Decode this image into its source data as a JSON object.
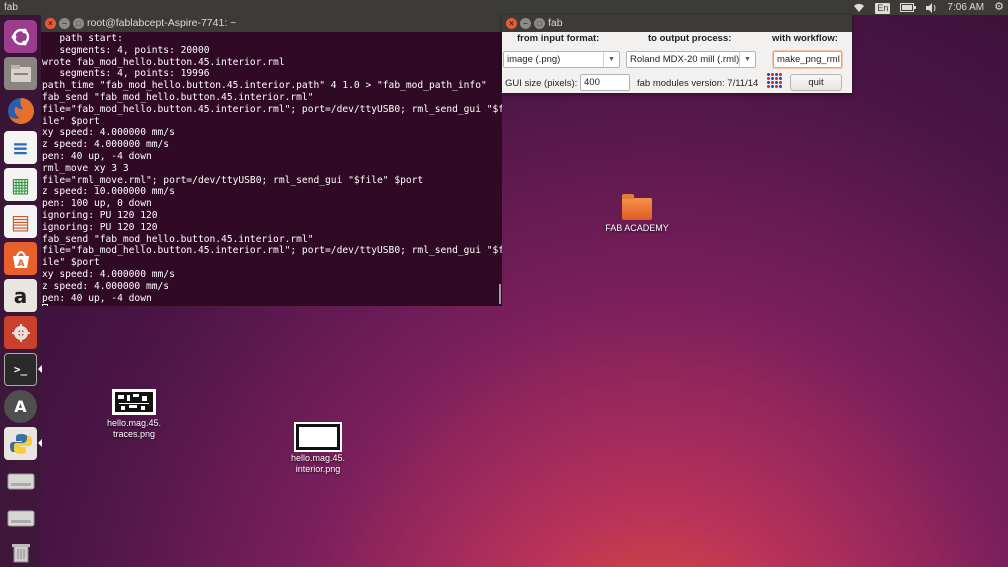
{
  "top_panel": {
    "app_name": "fab",
    "keyboard_layout": "En",
    "time": "7:06 AM",
    "icons": [
      "wifi-icon",
      "keyboard-icon",
      "battery-icon",
      "volume-icon",
      "settings-gear-icon"
    ]
  },
  "launcher": {
    "items": [
      {
        "name": "ubuntu-dash-icon",
        "color": "#9c3c8c"
      },
      {
        "name": "files-icon",
        "color": "#8a8580"
      },
      {
        "name": "firefox-icon",
        "color": "#e0672a"
      },
      {
        "name": "libreoffice-writer-icon",
        "color": "#2d6cb5"
      },
      {
        "name": "libreoffice-calc-icon",
        "color": "#2f9b3e"
      },
      {
        "name": "libreoffice-impress-icon",
        "color": "#d0562f"
      },
      {
        "name": "software-center-icon",
        "color": "#e8612c"
      },
      {
        "name": "amazon-icon",
        "color": "#d9d5cf"
      },
      {
        "name": "system-settings-icon",
        "color": "#c9402d"
      },
      {
        "name": "terminal-icon",
        "color": "#2a2a2a"
      },
      {
        "name": "software-updater-icon",
        "color": "#4f4f4f"
      },
      {
        "name": "python-icon",
        "color": "#3a6ea5"
      },
      {
        "name": "drive-icon",
        "color": "#bfbfbf"
      },
      {
        "name": "drive-2-icon",
        "color": "#bfbfbf"
      },
      {
        "name": "trash-icon",
        "color": "#9a9a9a"
      }
    ],
    "labels": {
      "amazon": "a",
      "terminal": ">_",
      "software_updater": "A",
      "writer": "≡",
      "calc": "▦",
      "impress": "▤"
    }
  },
  "terminal": {
    "title": "root@fablabcept-Aspire-7741: ~",
    "lines": [
      "   path start:",
      "   segments: 4, points: 20000",
      "wrote fab_mod_hello.button.45.interior.rml",
      "   segments: 4, points: 19996",
      "path_time \"fab_mod_hello.button.45.interior.path\" 4 1.0 > \"fab_mod_path_info\"",
      "fab_send \"fab_mod_hello.button.45.interior.rml\"",
      "file=\"fab_mod_hello.button.45.interior.rml\"; port=/dev/ttyUSB0; rml_send_gui \"$f",
      "ile\" $port",
      "xy speed: 4.000000 mm/s",
      "z speed: 4.000000 mm/s",
      "pen: 40 up, -4 down",
      "rml_move xy 3 3",
      "file=\"rml_move.rml\"; port=/dev/ttyUSB0; rml_send_gui \"$file\" $port",
      "z speed: 10.000000 mm/s",
      "pen: 100 up, 0 down",
      "ignoring: PU 120 120",
      "ignoring: PU 120 120",
      "fab_send \"fab_mod_hello.button.45.interior.rml\"",
      "file=\"fab_mod_hello.button.45.interior.rml\"; port=/dev/ttyUSB0; rml_send_gui \"$f",
      "ile\" $port",
      "xy speed: 4.000000 mm/s",
      "z speed: 4.000000 mm/s",
      "pen: 40 up, -4 down",
      ""
    ]
  },
  "fab_window": {
    "title": "fab",
    "from_label": "from input format:",
    "to_label": "to output process:",
    "workflow_label": "with workflow:",
    "input_format": "image (.png)",
    "output_process": "Roland MDX-20 mill (.rml)",
    "workflow": "make_png_rml",
    "gui_size_label": "GUI size (pixels):",
    "gui_size_value": "400",
    "version_text": "fab modules version: 7/11/14",
    "quit_label": "quit"
  },
  "desktop": {
    "icons": [
      {
        "label": "FAB ACADEMY",
        "type": "folder"
      },
      {
        "label": "hello.mag.45.\ntraces.png",
        "type": "image"
      },
      {
        "label": "hello.mag.45.\ninterior.png",
        "type": "image"
      }
    ]
  },
  "colors": {
    "terminal_bg": "#300a24",
    "panel_bg": "#3c3b37",
    "close_button": "#e8593a",
    "folder_orange": "#f0823c"
  }
}
